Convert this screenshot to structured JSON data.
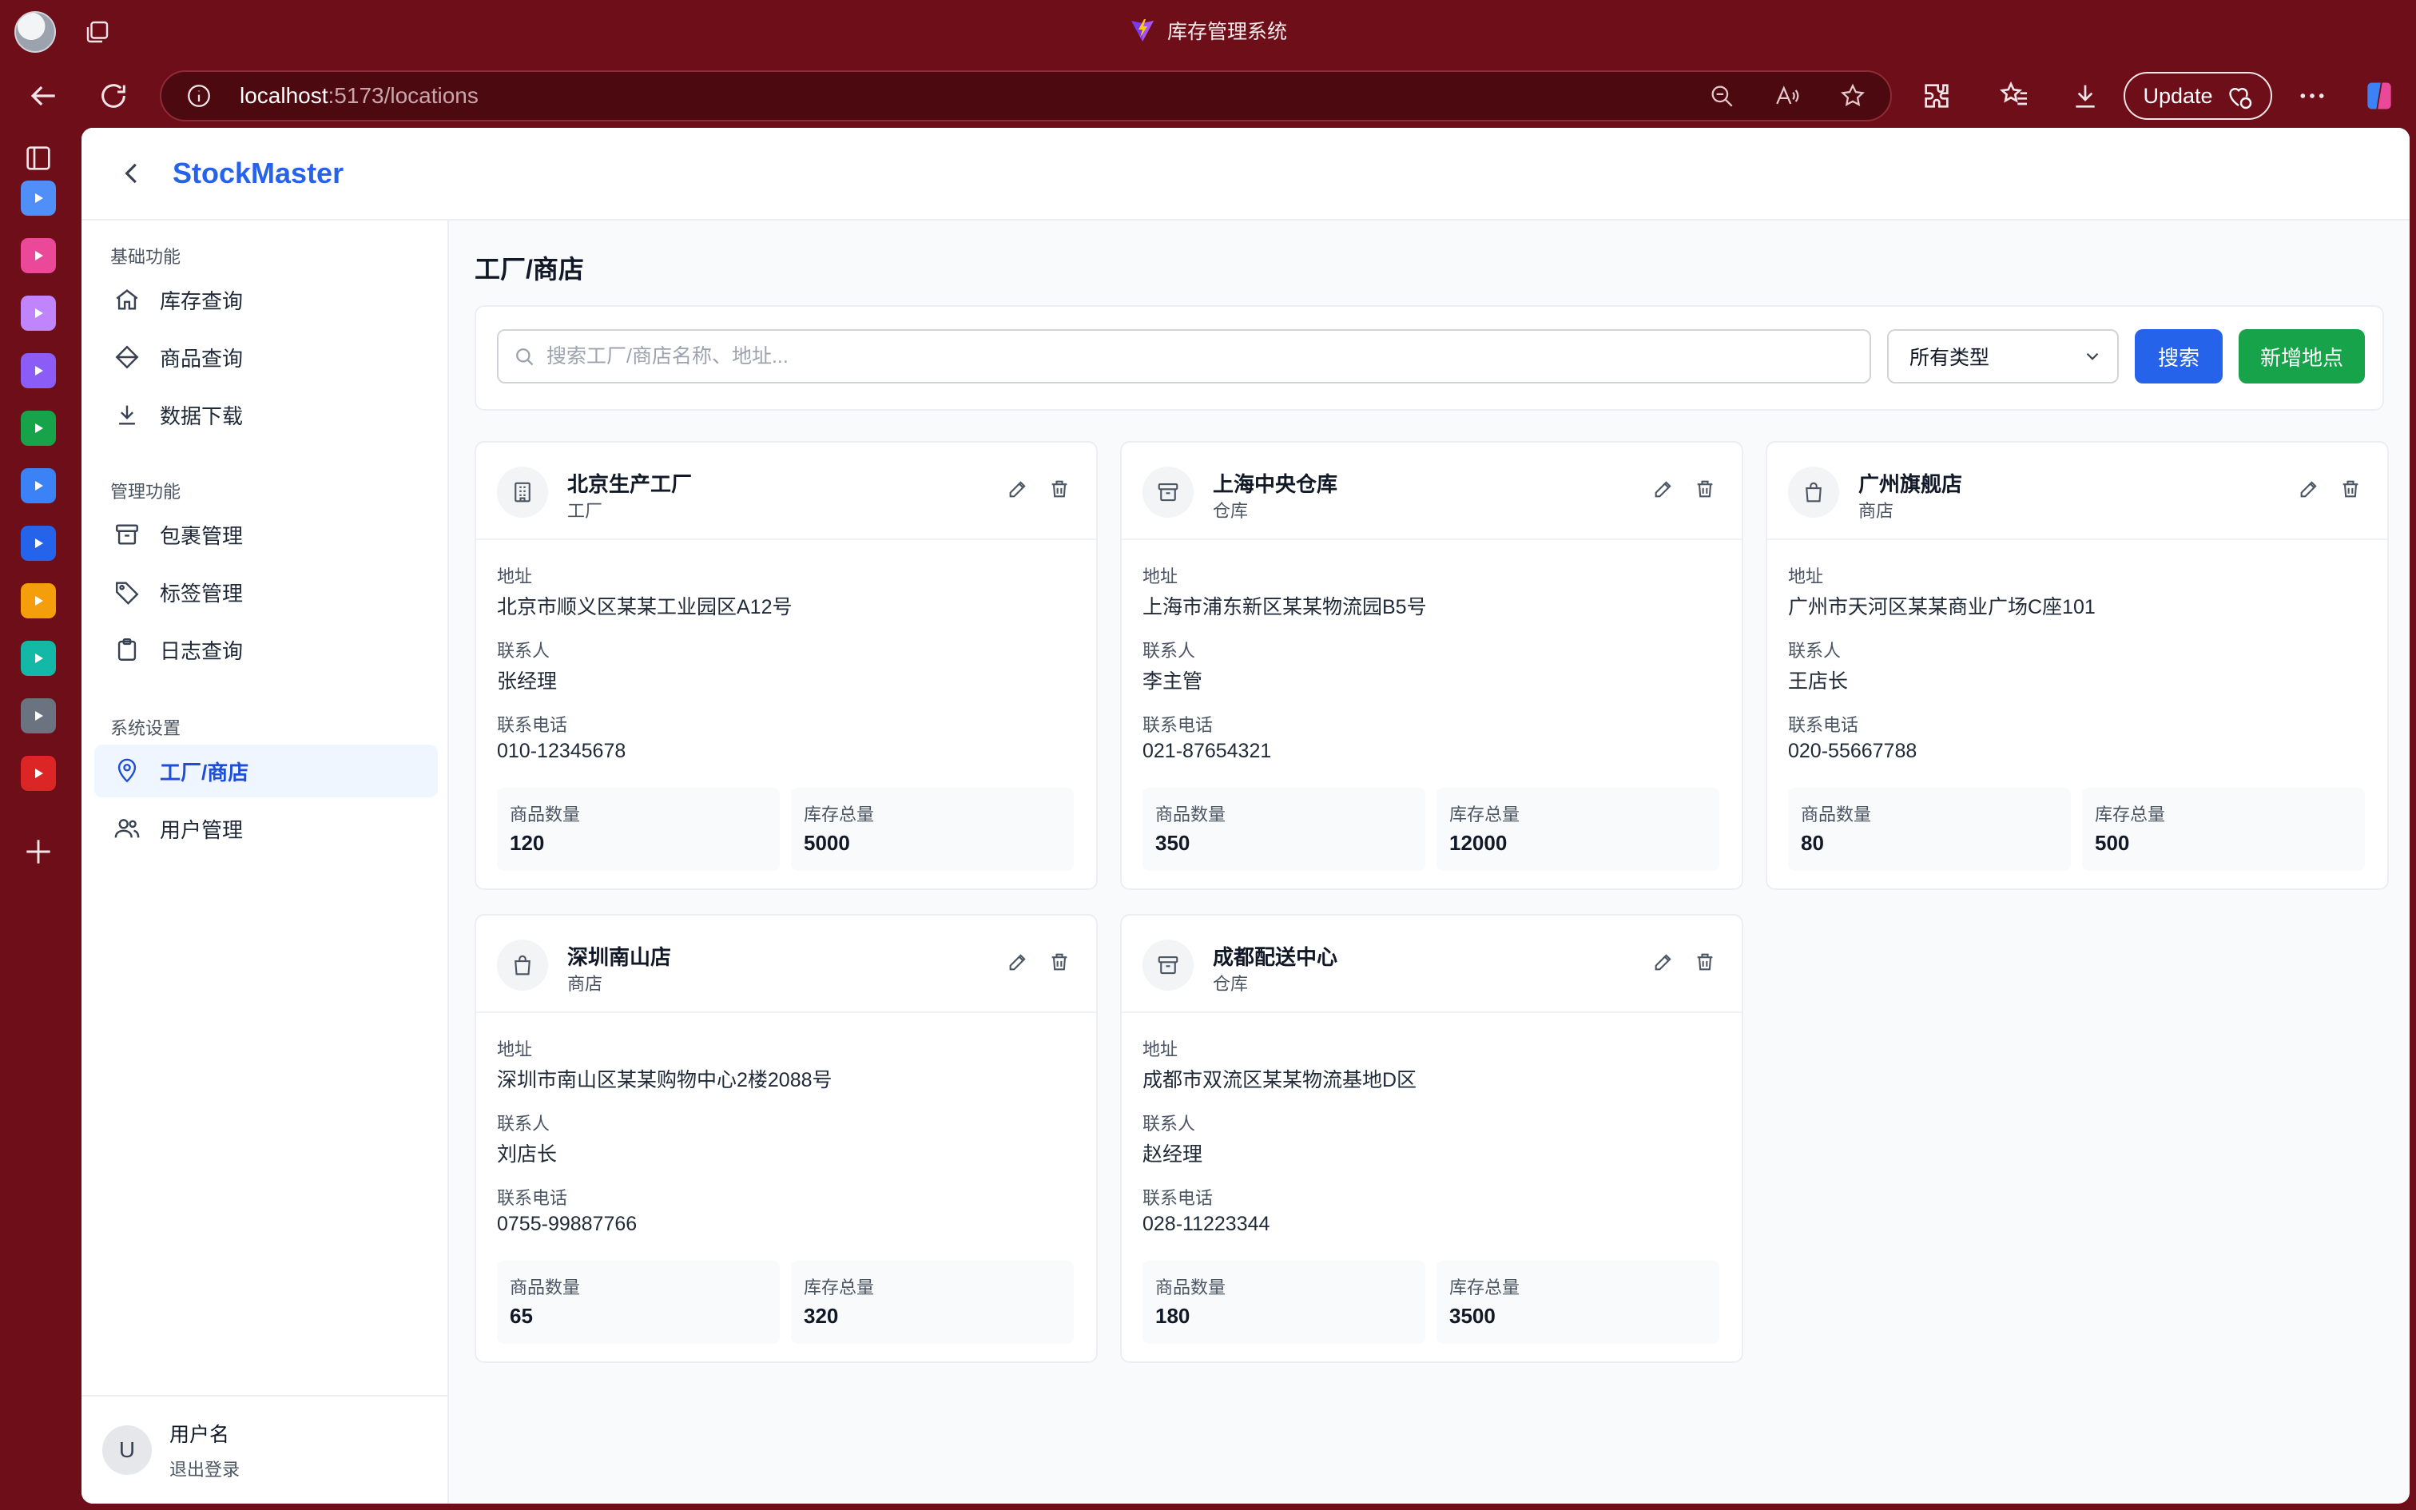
{
  "browser": {
    "window_title": "库存管理系统",
    "url_host": "localhost",
    "url_rest": ":5173/locations",
    "update_label": "Update",
    "accent": "#6e0e19"
  },
  "rail": [
    {
      "name": "rail-app-1",
      "color": "#4f8ff7"
    },
    {
      "name": "rail-app-2",
      "color": "#ec4899"
    },
    {
      "name": "rail-app-3",
      "color": "#c084fc"
    },
    {
      "name": "rail-app-4",
      "color": "#8b5cf6"
    },
    {
      "name": "rail-app-5",
      "color": "#16a34a"
    },
    {
      "name": "rail-app-6",
      "color": "#3b82f6"
    },
    {
      "name": "rail-app-7",
      "color": "#2563eb"
    },
    {
      "name": "rail-app-8",
      "color": "#f59e0b"
    },
    {
      "name": "rail-app-9",
      "color": "#14b8a6"
    },
    {
      "name": "rail-app-10",
      "color": "#6b7280"
    },
    {
      "name": "rail-app-11",
      "color": "#dc2626"
    }
  ],
  "app": {
    "brand": "StockMaster",
    "brand_color": "#2563eb"
  },
  "sidebar": {
    "sections": [
      {
        "title": "基础功能",
        "items": [
          {
            "label": "库存查询",
            "icon": "home-icon"
          },
          {
            "label": "商品查询",
            "icon": "tag-diamond-icon"
          },
          {
            "label": "数据下载",
            "icon": "download-icon"
          }
        ]
      },
      {
        "title": "管理功能",
        "items": [
          {
            "label": "包裹管理",
            "icon": "archive-icon"
          },
          {
            "label": "标签管理",
            "icon": "label-icon"
          },
          {
            "label": "日志查询",
            "icon": "clipboard-icon"
          }
        ]
      },
      {
        "title": "系统设置",
        "items": [
          {
            "label": "工厂/商店",
            "icon": "map-pin-icon",
            "active": true
          },
          {
            "label": "用户管理",
            "icon": "users-icon"
          }
        ]
      }
    ],
    "user": {
      "initial": "U",
      "name": "用户名",
      "logout": "退出登录"
    }
  },
  "main": {
    "title": "工厂/商店",
    "search_placeholder": "搜索工厂/商店名称、地址...",
    "type_select": "所有类型",
    "search_button": "搜索",
    "add_button": "新增地点",
    "labels": {
      "address": "地址",
      "contact": "联系人",
      "phone": "联系电话",
      "product_count": "商品数量",
      "stock_total": "库存总量"
    },
    "locations": [
      {
        "name": "北京生产工厂",
        "type": "工厂",
        "icon": "building-icon",
        "address": "北京市顺义区某某工业园区A12号",
        "contact": "张经理",
        "phone": "010-12345678",
        "product_count": "120",
        "stock_total": "5000"
      },
      {
        "name": "上海中央仓库",
        "type": "仓库",
        "icon": "archive-icon",
        "address": "上海市浦东新区某某物流园B5号",
        "contact": "李主管",
        "phone": "021-87654321",
        "product_count": "350",
        "stock_total": "12000"
      },
      {
        "name": "广州旗舰店",
        "type": "商店",
        "icon": "shopping-bag-icon",
        "address": "广州市天河区某某商业广场C座101",
        "contact": "王店长",
        "phone": "020-55667788",
        "product_count": "80",
        "stock_total": "500"
      },
      {
        "name": "深圳南山店",
        "type": "商店",
        "icon": "shopping-bag-icon",
        "address": "深圳市南山区某某购物中心2楼2088号",
        "contact": "刘店长",
        "phone": "0755-99887766",
        "product_count": "65",
        "stock_total": "320"
      },
      {
        "name": "成都配送中心",
        "type": "仓库",
        "icon": "archive-icon",
        "address": "成都市双流区某某物流基地D区",
        "contact": "赵经理",
        "phone": "028-11223344",
        "product_count": "180",
        "stock_total": "3500"
      }
    ]
  }
}
